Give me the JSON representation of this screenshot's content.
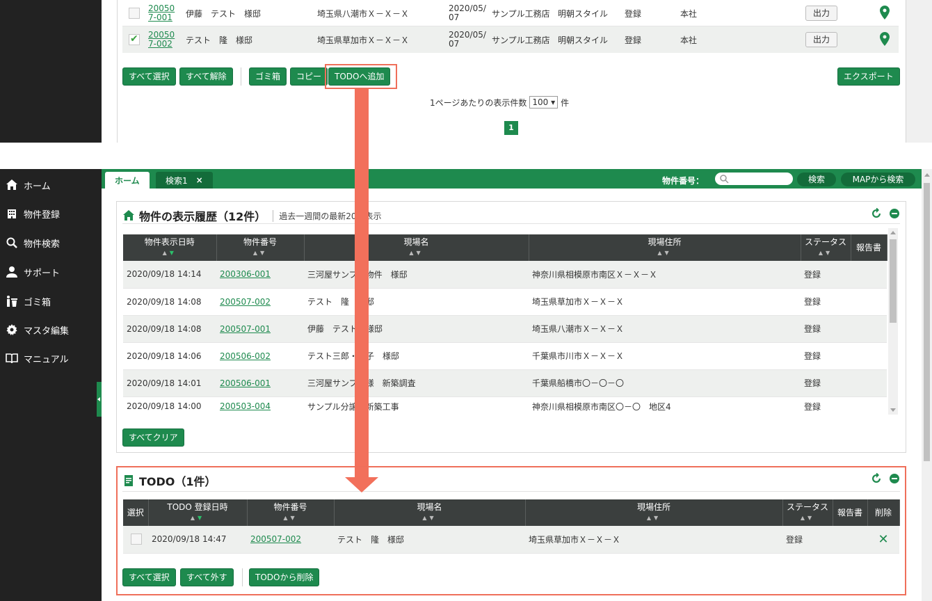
{
  "top_table": {
    "rows": [
      {
        "checked": false,
        "id_line1": "20050",
        "id_line2": "7-001",
        "site": "伊藤　テスト　様邸",
        "address": "埼玉県八潮市Ｘ－Ｘ－Ｘ",
        "date_line1": "2020/05/",
        "date_line2": "07",
        "company": "サンプル工務店",
        "style": "明朝スタイル",
        "status": "登録",
        "office": "本社",
        "output_label": "出力"
      },
      {
        "checked": true,
        "id_line1": "20050",
        "id_line2": "7-002",
        "site": "テスト　隆　様邸",
        "address": "埼玉県草加市Ｘ－Ｘ－Ｘ",
        "date_line1": "2020/05/",
        "date_line2": "07",
        "company": "サンプル工務店",
        "style": "明朝スタイル",
        "status": "登録",
        "office": "本社",
        "output_label": "出力"
      }
    ],
    "buttons": {
      "select_all": "すべて選択",
      "deselect_all": "すべて解除",
      "trash": "ゴミ箱",
      "copy": "コピー",
      "add_todo": "TODOへ追加",
      "export": "エクスポート"
    },
    "pager": {
      "prefix": "1ページあたりの表示件数",
      "value": "100",
      "suffix": "件",
      "page": "1"
    }
  },
  "sidebar": {
    "items": [
      {
        "label": "ホーム",
        "icon": "home-icon"
      },
      {
        "label": "物件登録",
        "icon": "building-icon"
      },
      {
        "label": "物件検索",
        "icon": "search-icon"
      },
      {
        "label": "サポート",
        "icon": "user-icon"
      },
      {
        "label": "ゴミ箱",
        "icon": "trash-person-icon"
      },
      {
        "label": "マスタ編集",
        "icon": "gear-icon"
      },
      {
        "label": "マニュアル",
        "icon": "book-icon"
      }
    ]
  },
  "tabbar": {
    "tabs": [
      {
        "label": "ホーム"
      },
      {
        "label": "検索1",
        "close": "×"
      }
    ],
    "search_label": "物件番号：",
    "search_button": "検索",
    "map_button": "MAPから検索"
  },
  "history": {
    "title": "物件の表示履歴（12件）",
    "subtitle": "過去一週間の最新20件表示",
    "columns": [
      "物件表示日時",
      "物件番号",
      "現場名",
      "現場住所",
      "ステータス",
      "報告書"
    ],
    "rows": [
      {
        "datetime": "2020/09/18 14:14",
        "id": "200306-001",
        "site": "三河屋サンプル物件　様邸",
        "address": "神奈川県相模原市南区Ｘ－Ｘ－Ｘ",
        "status": "登録"
      },
      {
        "datetime": "2020/09/18 14:08",
        "id": "200507-002",
        "site": "テスト　隆　様邸",
        "address": "埼玉県草加市Ｘ－Ｘ－Ｘ",
        "status": "登録"
      },
      {
        "datetime": "2020/09/18 14:08",
        "id": "200507-001",
        "site": "伊藤　テスト　様邸",
        "address": "埼玉県八潮市Ｘ－Ｘ－Ｘ",
        "status": "登録"
      },
      {
        "datetime": "2020/09/18 14:06",
        "id": "200506-002",
        "site": "テスト三郎・花子　様邸",
        "address": "千葉県市川市Ｘ－Ｘ－Ｘ",
        "status": "登録"
      },
      {
        "datetime": "2020/09/18 14:01",
        "id": "200506-001",
        "site": "三河屋サンプル様　新築調査",
        "address": "千葉県船橋市〇－〇－〇",
        "status": "登録"
      },
      {
        "datetime": "2020/09/18 14:00",
        "id": "200503-004",
        "site": "サンプル分譲　新築工事",
        "address": "神奈川県相模原市南区〇－〇　地区4",
        "status": "登録"
      }
    ],
    "clear_button": "すべてクリア"
  },
  "todo": {
    "title": "TODO（1件）",
    "columns": [
      "選択",
      "TODO 登録日時",
      "物件番号",
      "現場名",
      "現場住所",
      "ステータス",
      "報告書",
      "削除"
    ],
    "rows": [
      {
        "datetime": "2020/09/18 14:47",
        "id": "200507-002",
        "site": "テスト　隆　様邸",
        "address": "埼玉県草加市Ｘ－Ｘ－Ｘ",
        "status": "登録",
        "delete": "✕"
      }
    ],
    "buttons": {
      "select_all": "すべて選択",
      "deselect_all": "すべて外す",
      "remove": "TODOから削除"
    }
  },
  "colors": {
    "brand_green": "#1e8a4e",
    "highlight": "#f2705b",
    "dark": "#222222"
  }
}
